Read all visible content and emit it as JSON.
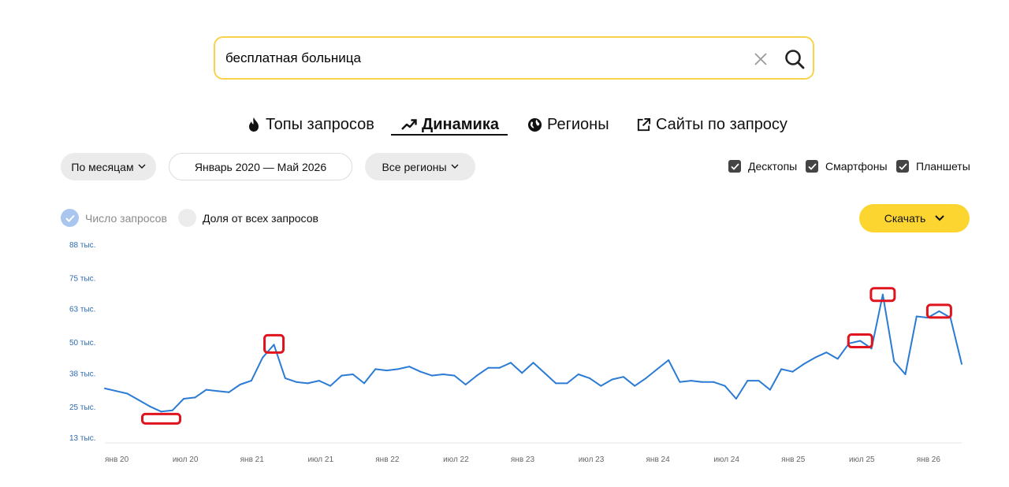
{
  "search": {
    "value": "бесплатная больница"
  },
  "tabs": [
    {
      "label": "Топы запросов",
      "icon": "fire-icon"
    },
    {
      "label": "Динамика",
      "icon": "trend-icon"
    },
    {
      "label": "Регионы",
      "icon": "globe-icon"
    },
    {
      "label": "Сайты по запросу",
      "icon": "external-link-icon"
    }
  ],
  "filters": {
    "period_label": "По месяцам",
    "date_range": "Январь 2020 — Май 2026",
    "region_label": "Все регионы"
  },
  "devices": [
    {
      "label": "Десктопы",
      "checked": true
    },
    {
      "label": "Смартфоны",
      "checked": true
    },
    {
      "label": "Планшеты",
      "checked": true
    }
  ],
  "options": {
    "count_label": "Число запросов",
    "share_label": "Доля от всех запросов"
  },
  "download_label": "Скачать",
  "colors": {
    "accent": "#fcd531",
    "line": "#2b7bd4",
    "highlight": "#e0141e",
    "search_border": "#f8d24a"
  },
  "chart_data": {
    "type": "line",
    "y_ticks": [
      "13 тыс.",
      "25 тыс.",
      "38 тыс.",
      "50 тыс.",
      "63 тыс.",
      "75 тыс.",
      "88 тыс."
    ],
    "y_tick_values": [
      13000,
      25000,
      38000,
      50000,
      63000,
      75000,
      88000
    ],
    "ylim": [
      13000,
      88000
    ],
    "x_ticks": [
      "янв 20",
      "июл 20",
      "янв 21",
      "июл 21",
      "янв 22",
      "июл 22",
      "янв 23",
      "июл 23",
      "янв 24",
      "июл 24",
      "янв 25",
      "июл 25",
      "янв 26"
    ],
    "grid": false,
    "series": [
      {
        "start": "2020-01",
        "values": [
          32000,
          31000,
          30000,
          27500,
          25000,
          23000,
          23500,
          28000,
          28500,
          31500,
          31000,
          30500,
          33500,
          35000,
          44000,
          49000,
          36000,
          34500,
          34000,
          35000,
          33000,
          37000,
          37500,
          34000,
          39500,
          39000,
          39500,
          40500,
          38500,
          37000,
          37500,
          37000,
          33500,
          37000,
          40000,
          40000,
          42000,
          38000,
          42000,
          38000,
          34000,
          34000,
          37500,
          36000,
          33000,
          35500,
          36500,
          33000,
          36000,
          39500,
          43000,
          34500,
          35000,
          34500,
          34500,
          33000,
          28000,
          35000,
          35000,
          31500,
          39500,
          38500,
          41500,
          44000,
          46000,
          43500,
          49500,
          50500,
          47500,
          68500,
          42500,
          37500,
          60000,
          59500,
          62000,
          59500,
          41500
        ]
      }
    ],
    "highlighted_months": [
      "2020-06",
      "2021-04",
      "2025-08",
      "2025-10",
      "2026-03"
    ]
  }
}
